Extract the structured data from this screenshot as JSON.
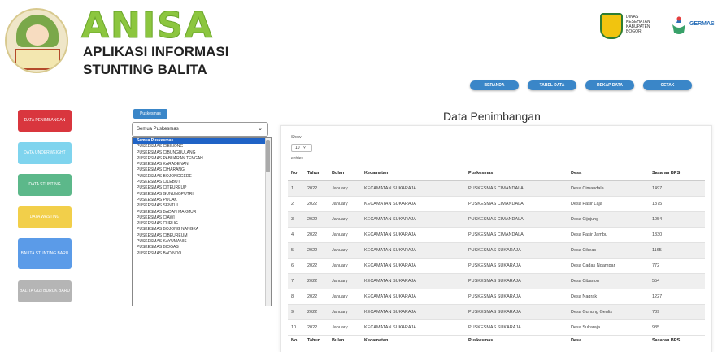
{
  "header": {
    "logo_title": "ANISA",
    "subtitle_line1": "APLIKASI INFORMASI",
    "subtitle_line2": "STUNTING BALITA",
    "gov_text": "DINAS KESEHATAN KABUPATEN BOGOR",
    "germas_text": "GERMAS"
  },
  "topnav": [
    {
      "label": "BERANDA"
    },
    {
      "label": "TABEL DATA"
    },
    {
      "label": "REKAP DATA"
    },
    {
      "label": "CETAK"
    }
  ],
  "sidebar": [
    {
      "label": "DATA PENIMBANGAN",
      "color": "#d9363e"
    },
    {
      "label": "DATA UNDERWEIGHT",
      "color": "#7fd4ee"
    },
    {
      "label": "DATA STUNTING",
      "color": "#5cb88a"
    },
    {
      "label": "DATA WASTING",
      "color": "#f2cf4a"
    },
    {
      "label": "BALITA STUNTING BARU",
      "color": "#5b9be8"
    },
    {
      "label": "BALITA GIZI BURUK BARU",
      "color": "#b5b5b5"
    }
  ],
  "filter": {
    "tag": "Puskesmas",
    "selected": "Semua Puskesmas",
    "options": [
      "Semua Puskesmas",
      "PUSKESMAS CIBINONG",
      "PUSKESMAS CIBUNGBULANG",
      "PUSKESMAS PABUARAN TENGAH",
      "PUSKESMAS KARADENAN",
      "PUSKESMAS CIHARANG",
      "PUSKESMAS BOJONGGEDE",
      "PUSKESMAS CILEBUT",
      "PUSKESMAS CITEUREUP",
      "PUSKESMAS GUNUNGPUTRI",
      "PUSKESMAS PUCAK",
      "PUSKESMAS SENTUL",
      "PUSKESMAS BADAN MAKMUR",
      "PUSKESMAS CIAWI",
      "PUSKESMAS CURUG",
      "PUSKESMAS BOJONG NANGKA",
      "PUSKESMAS CIBEUREUM",
      "PUSKESMAS KAYUMANIS",
      "PUSKESMAS BIOGAS",
      "PUSKESMAS BADINDO"
    ]
  },
  "panel": {
    "title": "Data Penimbangan",
    "show_label": "Show",
    "show_value": "10",
    "entries_label": "entries",
    "columns": [
      "No",
      "Tahun",
      "Bulan",
      "Kecamatan",
      "Puskesmas",
      "Desa",
      "Sasaran BPS"
    ],
    "rows": [
      [
        "1",
        "2022",
        "January",
        "KECAMATAN SUKARAJA",
        "PUSKESMAS CIMANDALA",
        "Desa Cimandala",
        "1497"
      ],
      [
        "2",
        "2022",
        "January",
        "KECAMATAN SUKARAJA",
        "PUSKESMAS CIMANDALA",
        "Desa Pasir Laja",
        "1375"
      ],
      [
        "3",
        "2022",
        "January",
        "KECAMATAN SUKARAJA",
        "PUSKESMAS CIMANDALA",
        "Desa Cijujung",
        "1054"
      ],
      [
        "4",
        "2022",
        "January",
        "KECAMATAN SUKARAJA",
        "PUSKESMAS CIMANDALA",
        "Desa Pasir Jambu",
        "1330"
      ],
      [
        "5",
        "2022",
        "January",
        "KECAMATAN SUKARAJA",
        "PUSKESMAS SUKARAJA",
        "Desa Cikeas",
        "1165"
      ],
      [
        "6",
        "2022",
        "January",
        "KECAMATAN SUKARAJA",
        "PUSKESMAS SUKARAJA",
        "Desa Cadas Ngampar",
        "772"
      ],
      [
        "7",
        "2022",
        "January",
        "KECAMATAN SUKARAJA",
        "PUSKESMAS SUKARAJA",
        "Desa Cibanon",
        "554"
      ],
      [
        "8",
        "2022",
        "January",
        "KECAMATAN SUKARAJA",
        "PUSKESMAS SUKARAJA",
        "Desa Nagrak",
        "1227"
      ],
      [
        "9",
        "2022",
        "January",
        "KECAMATAN SUKARAJA",
        "PUSKESMAS SUKARAJA",
        "Desa Gunung Geulis",
        "789"
      ],
      [
        "10",
        "2022",
        "January",
        "KECAMATAN SUKARAJA",
        "PUSKESMAS SUKARAJA",
        "Desa Sukaraja",
        "985"
      ]
    ]
  }
}
